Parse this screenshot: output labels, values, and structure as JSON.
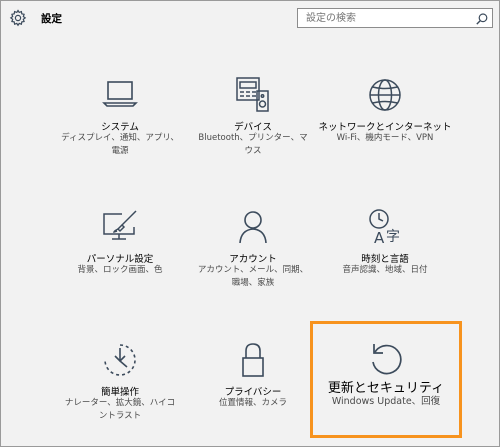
{
  "header": {
    "title": "設定",
    "search_placeholder": "設定の検索"
  },
  "tiles": [
    {
      "name": "システム",
      "desc": "ディスプレイ、通知、アプリ、\n電源",
      "icon": "laptop-icon"
    },
    {
      "name": "デバイス",
      "desc": "Bluetooth、プリンター、マ\nウス",
      "icon": "devices-icon"
    },
    {
      "name": "ネットワークとインターネット",
      "desc": "Wi-Fi、機内モード、VPN",
      "icon": "globe-icon"
    },
    {
      "name": "パーソナル設定",
      "desc": "背景、ロック画面、色",
      "icon": "personalization-icon"
    },
    {
      "name": "アカウント",
      "desc": "アカウント、メール、同期、\n職場、家族",
      "icon": "person-icon"
    },
    {
      "name": "時刻と言語",
      "desc": "音声認識、地域、日付",
      "icon": "time-language-icon"
    },
    {
      "name": "簡単操作",
      "desc": "ナレーター、拡大鏡、ハイコ\nントラスト",
      "icon": "ease-of-access-icon"
    },
    {
      "name": "プライバシー",
      "desc": "位置情報、カメラ",
      "icon": "lock-icon"
    },
    {
      "name": "更新とセキュリティ",
      "desc": "Windows Update、回復",
      "icon": "refresh-icon"
    }
  ],
  "colors": {
    "background": "#f2f2f2",
    "icon": "#3c4b5c",
    "highlight": "#f7931e"
  }
}
